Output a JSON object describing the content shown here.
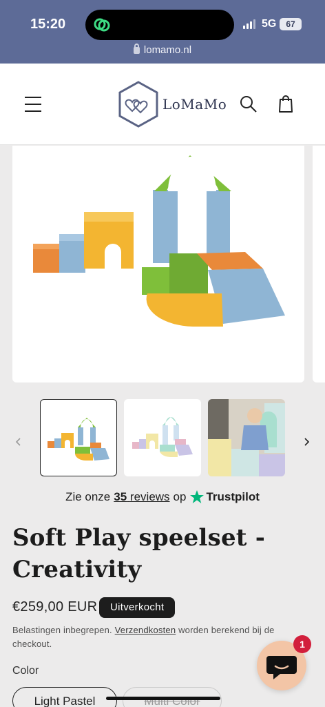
{
  "status_bar": {
    "time": "15:20",
    "network": "5G",
    "battery": "67"
  },
  "browser": {
    "url": "lomamo.nl"
  },
  "header": {
    "logo_text": "LoMaMo"
  },
  "reviews": {
    "prefix": "Zie onze",
    "count": "35",
    "link_label": "reviews",
    "suffix": "op",
    "platform": "Trustpilot"
  },
  "product": {
    "title": "Soft Play speelset - Creativity",
    "price": "€259,00 EUR",
    "badge": "Uitverkocht",
    "tax_prefix": "Belastingen inbegrepen.",
    "tax_link": "Verzendkosten",
    "tax_suffix": "worden berekend bij de checkout.",
    "color_label": "Color",
    "color_options": [
      "Light Pastel",
      "Multi Color"
    ],
    "selected_color": "Light Pastel"
  },
  "chat": {
    "badge_count": "1"
  },
  "colors": {
    "status_bg": "#5d6b97",
    "logo": "#2f3550",
    "badge_bg": "#1d1d1d",
    "chat_bg": "#f3c5a6",
    "notification": "#d21f3c"
  }
}
